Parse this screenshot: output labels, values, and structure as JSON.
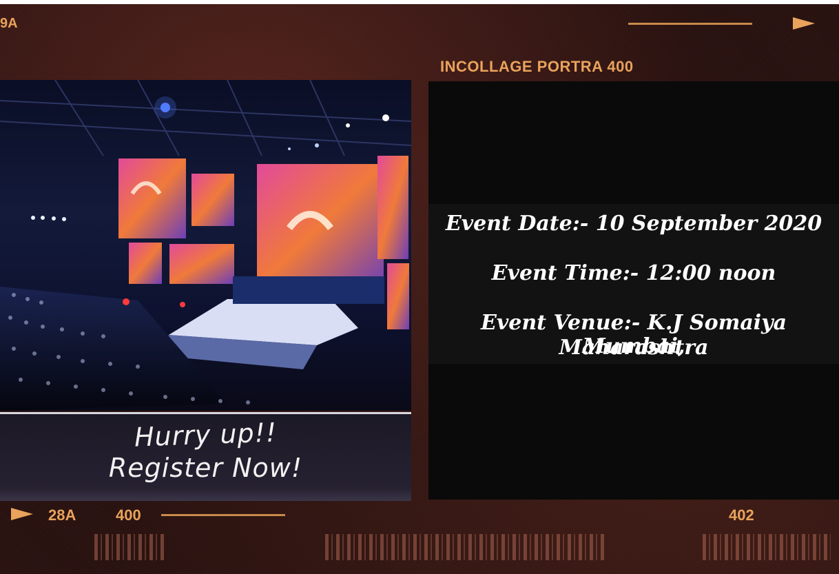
{
  "film": {
    "code_top_left": "9A",
    "label": "INCOLLAGE PORTRA  400",
    "bottom_left_code": "28A",
    "bottom_left_number": "400",
    "bottom_right_number": "402",
    "accent_color": "#e9a35c"
  },
  "caption": {
    "line1": "Hurry up!!",
    "line2": "Register Now!"
  },
  "event": {
    "date": "Event Date:- 10 September 2020",
    "time": "Event Time:- 12:00 noon",
    "venue_line1": "Event Venue:- K.J Somaiya Mumbai,",
    "venue_line2": "Maharashtra"
  }
}
